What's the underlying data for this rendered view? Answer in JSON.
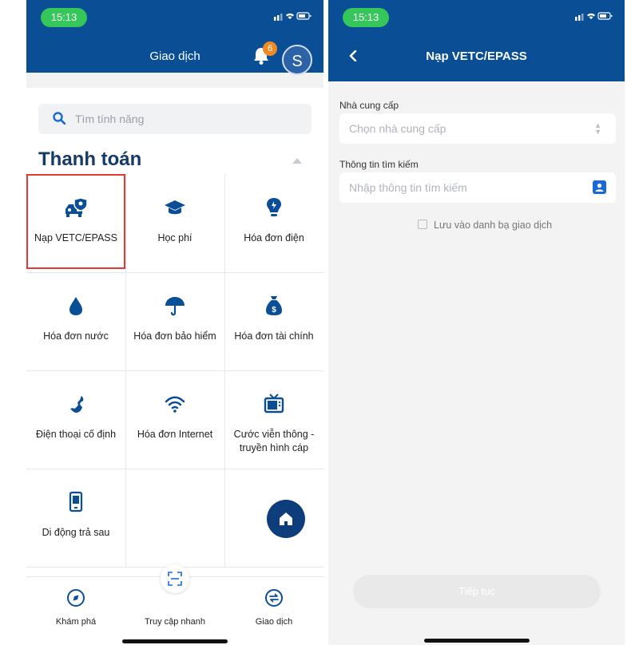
{
  "left_screen": {
    "status": {
      "time": "15:13",
      "icons": "signal wifi battery"
    },
    "header": {
      "title": "Giao dịch",
      "notification_count": "6",
      "avatar_letter": "S"
    },
    "search": {
      "placeholder": "Tìm tính năng"
    },
    "section": {
      "title": "Thanh toán"
    },
    "features": [
      {
        "label": "Nạp VETC/EPASS",
        "icon": "car-shield-icon"
      },
      {
        "label": "Học phí",
        "icon": "graduation-cap-icon"
      },
      {
        "label": "Hóa đơn điện",
        "icon": "lightbulb-icon"
      },
      {
        "label": "Hóa đơn nước",
        "icon": "water-drop-icon"
      },
      {
        "label": "Hóa đơn bảo hiểm",
        "icon": "umbrella-icon"
      },
      {
        "label": "Hóa đơn tài chính",
        "icon": "money-bag-icon"
      },
      {
        "label": "Điện thoại cố định",
        "icon": "phone-icon"
      },
      {
        "label": "Hóa đơn Internet",
        "icon": "wifi-icon"
      },
      {
        "label": "Cước viễn thông - truyền hình cáp",
        "icon": "tv-icon"
      },
      {
        "label": "Di động trả sau",
        "icon": "mobile-bill-icon"
      }
    ],
    "tabbar": [
      {
        "label": "Khám phá",
        "icon": "compass-icon"
      },
      {
        "label": "Truy cập nhanh",
        "icon": "scan-icon"
      },
      {
        "label": "Giao dịch",
        "icon": "exchange-icon"
      }
    ],
    "colors": {
      "primary": "#0a4f96",
      "accent": "#1a6ad6",
      "highlight": "#e53935"
    }
  },
  "right_screen": {
    "status": {
      "time": "15:13"
    },
    "header": {
      "title": "Nạp VETC/EPASS"
    },
    "provider": {
      "label": "Nhà cung cấp",
      "placeholder": "Chọn nhà cung cấp"
    },
    "search_info": {
      "label": "Thông tin tìm kiếm",
      "placeholder": "Nhập thông tin tìm kiếm"
    },
    "save_contact": {
      "label": "Lưu vào danh bạ giao dịch",
      "checked": false
    },
    "continue_label": "Tiếp tục"
  }
}
